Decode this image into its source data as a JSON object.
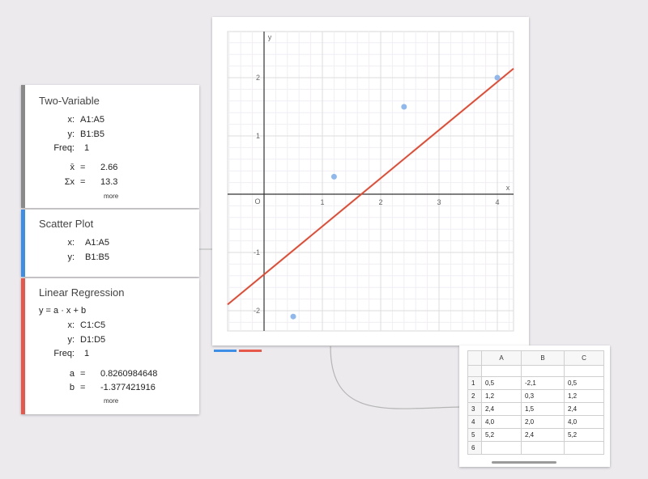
{
  "two_variable": {
    "title": "Two-Variable",
    "x_label": "x:",
    "x_value": "A1:A5",
    "y_label": "y:",
    "y_value": "B1:B5",
    "freq_label": "Freq:",
    "freq_value": "1",
    "mean_label": "x̄",
    "eq1": "=",
    "mean_value": "2.66",
    "sum_label": "Σx",
    "eq2": "=",
    "sum_value": "13.3",
    "more": "more",
    "color": "#8a8a8a"
  },
  "scatter_plot": {
    "title": "Scatter Plot",
    "x_label": "x:",
    "x_value": "A1:A5",
    "y_label": "y:",
    "y_value": "B1:B5",
    "color": "#3d8ee6"
  },
  "linear_regression": {
    "title": "Linear Regression",
    "formula": "y = a · x + b",
    "x_label": "x:",
    "x_value": "C1:C5",
    "y_label": "y:",
    "y_value": "D1:D5",
    "freq_label": "Freq:",
    "freq_value": "1",
    "a_label": "a",
    "eq1": "=",
    "a_value": "0.8260984648",
    "b_label": "b",
    "eq2": "=",
    "b_value": "-1.377421916",
    "more": "more",
    "color": "#e8584a"
  },
  "graph": {
    "x_axis_label": "x",
    "y_axis_label": "y",
    "origin_label": "O",
    "x_ticks": [
      "1",
      "2",
      "3",
      "4"
    ],
    "y_ticks": [
      "2",
      "1",
      "-1",
      "-2"
    ],
    "points": [
      [
        0.5,
        -2.1
      ],
      [
        1.2,
        0.3
      ],
      [
        2.4,
        1.5
      ],
      [
        4.0,
        2.0
      ]
    ],
    "regression": {
      "slope": 0.8260984648,
      "intercept": -1.377421916
    },
    "point_color": "#8fb8ee",
    "line_color": "#e8482f"
  },
  "spreadsheet": {
    "columns": [
      "A",
      "B",
      "C"
    ],
    "rows": [
      {
        "n": "1",
        "cells": [
          "0,5",
          "-2,1",
          "0,5"
        ]
      },
      {
        "n": "2",
        "cells": [
          "1,2",
          "0,3",
          "1,2"
        ]
      },
      {
        "n": "3",
        "cells": [
          "2,4",
          "1,5",
          "2,4"
        ]
      },
      {
        "n": "4",
        "cells": [
          "4,0",
          "2,0",
          "4,0"
        ]
      },
      {
        "n": "5",
        "cells": [
          "5,2",
          "2,4",
          "5,2"
        ]
      },
      {
        "n": "6",
        "cells": [
          "",
          "",
          ""
        ]
      }
    ]
  }
}
